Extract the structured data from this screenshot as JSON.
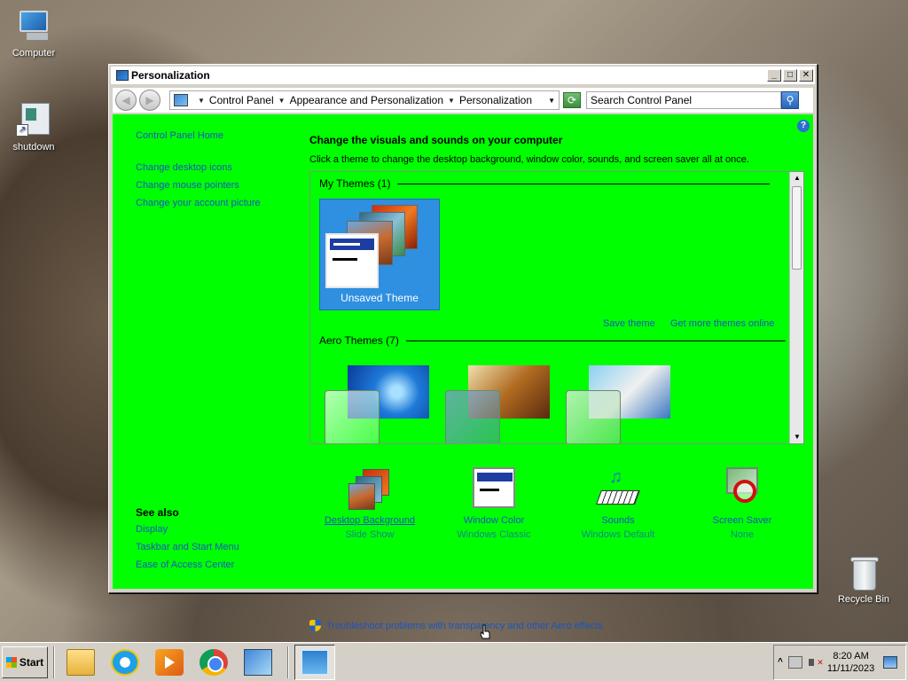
{
  "desktop": {
    "icons": [
      {
        "label": "Computer",
        "icon": "computer-icon"
      },
      {
        "label": "shutdown",
        "icon": "shortcut-icon"
      },
      {
        "label": "Recycle Bin",
        "icon": "recycle-bin-icon"
      }
    ]
  },
  "window": {
    "title": "Personalization",
    "breadcrumb": [
      "Control Panel",
      "Appearance and Personalization",
      "Personalization"
    ],
    "search_value": "Search Control Panel",
    "left_nav": {
      "home": "Control Panel Home",
      "links": [
        "Change desktop icons",
        "Change mouse pointers",
        "Change your account picture"
      ]
    },
    "see_also": {
      "heading": "See also",
      "links": [
        "Display",
        "Taskbar and Start Menu",
        "Ease of Access Center"
      ]
    },
    "main": {
      "heading": "Change the visuals and sounds on your computer",
      "description": "Click a theme to change the desktop background, window color, sounds, and screen saver all at once."
    },
    "themes": {
      "my_themes_header": "My Themes (1)",
      "selected_theme": "Unsaved Theme",
      "save_theme": "Save theme",
      "get_more": "Get more themes online",
      "aero_header": "Aero Themes (7)"
    },
    "settings": [
      {
        "label": "Desktop Background",
        "value": "Slide Show"
      },
      {
        "label": "Window Color",
        "value": "Windows Classic"
      },
      {
        "label": "Sounds",
        "value": "Windows Default"
      },
      {
        "label": "Screen Saver",
        "value": "None"
      }
    ],
    "troubleshoot": "Troubleshoot problems with transparency and other Aero effects"
  },
  "taskbar": {
    "start_label": "Start",
    "apps": [
      "file-explorer",
      "internet-explorer",
      "media-player",
      "chrome",
      "control-panel-task",
      "personalization-window"
    ],
    "clock_time": "8:20 AM",
    "clock_date": "11/11/2023"
  },
  "colors": {
    "content_background": "#00ff00",
    "link": "#1a55c0",
    "selected_theme": "#2f8fe0"
  }
}
